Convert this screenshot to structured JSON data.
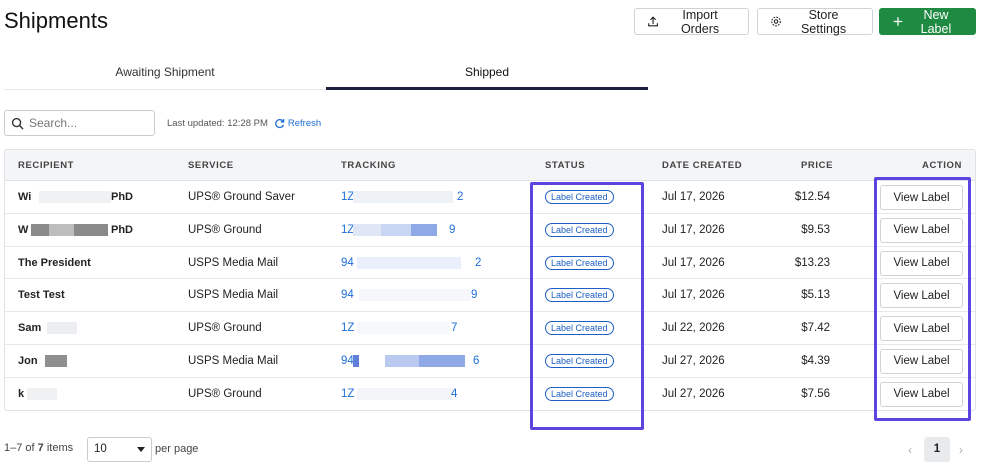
{
  "header": {
    "title": "Shipments",
    "import_label": "Import Orders",
    "settings_label": "Store Settings",
    "new_label": "New Label",
    "accent_color": "#1f8a41"
  },
  "tabs": [
    {
      "label": "Awaiting Shipment",
      "active": false
    },
    {
      "label": "Shipped",
      "active": true
    }
  ],
  "toolbar": {
    "search_placeholder": "Search...",
    "last_updated": "Last updated: 12:28 PM",
    "refresh_label": "Refresh"
  },
  "table": {
    "columns": [
      "RECIPIENT",
      "SERVICE",
      "TRACKING",
      "STATUS",
      "DATE CREATED",
      "PRICE",
      "ACTION"
    ],
    "rows": [
      {
        "recipient": "Wi",
        "recipient_suffix": "PhD",
        "service": "UPS® Ground Saver",
        "tracking_start": "1Z",
        "tracking_end": "2",
        "status": "Label Created",
        "date": "Jul 17, 2026",
        "price": "$12.54",
        "action": "View Label"
      },
      {
        "recipient": "W",
        "recipient_suffix": "PhD",
        "service": "UPS® Ground",
        "tracking_start": "1Z",
        "tracking_end": "9",
        "status": "Label Created",
        "date": "Jul 17, 2026",
        "price": "$9.53",
        "action": "View Label"
      },
      {
        "recipient": "The President",
        "recipient_suffix": "",
        "service": "USPS Media Mail",
        "tracking_start": "94",
        "tracking_end": "2",
        "status": "Label Created",
        "date": "Jul 17, 2026",
        "price": "$13.23",
        "action": "View Label"
      },
      {
        "recipient": "Test Test",
        "recipient_suffix": "",
        "service": "USPS Media Mail",
        "tracking_start": "94",
        "tracking_end": "9",
        "status": "Label Created",
        "date": "Jul 17, 2026",
        "price": "$5.13",
        "action": "View Label"
      },
      {
        "recipient": "Sam",
        "recipient_suffix": "",
        "service": "UPS® Ground",
        "tracking_start": "1Z",
        "tracking_end": "7",
        "status": "Label Created",
        "date": "Jul 22, 2026",
        "price": "$7.42",
        "action": "View Label"
      },
      {
        "recipient": "Jon",
        "recipient_suffix": "",
        "service": "USPS Media Mail",
        "tracking_start": "94",
        "tracking_end": "6",
        "status": "Label Created",
        "date": "Jul 27, 2026",
        "price": "$4.39",
        "action": "View Label"
      },
      {
        "recipient": "k",
        "recipient_suffix": "",
        "service": "UPS® Ground",
        "tracking_start": "1Z",
        "tracking_end": "4",
        "status": "Label Created",
        "date": "Jul 27, 2026",
        "price": "$7.56",
        "action": "View Label"
      }
    ]
  },
  "footer": {
    "range": "1–7",
    "of_label": "of",
    "total": "7",
    "items_label": "items",
    "per_page_value": "10",
    "per_page_label": "per page",
    "current_page": "1",
    "prev_icon": "chevron-left-icon",
    "next_icon": "chevron-right-icon"
  },
  "highlight_color": "#5b45e0"
}
